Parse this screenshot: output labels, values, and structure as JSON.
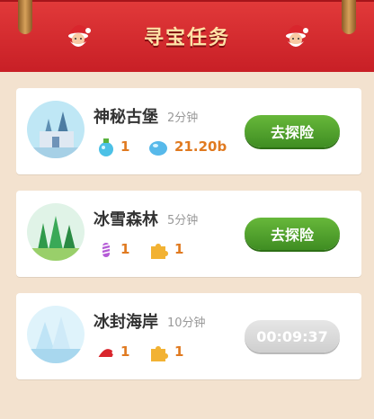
{
  "header": {
    "title": "寻宝任务"
  },
  "tasks": [
    {
      "name": "神秘古堡",
      "duration": "2分钟",
      "rewards": [
        {
          "icon": "potion-icon",
          "value": "1"
        },
        {
          "icon": "diamond-icon",
          "value": "21.20b"
        }
      ],
      "action": "去探险"
    },
    {
      "name": "冰雪森林",
      "duration": "5分钟",
      "rewards": [
        {
          "icon": "candy-icon",
          "value": "1"
        },
        {
          "icon": "puzzle-piece-icon",
          "value": "1"
        }
      ],
      "action": "去探险"
    },
    {
      "name": "冰封海岸",
      "duration": "10分钟",
      "rewards": [
        {
          "icon": "santa-hat-icon",
          "value": "1"
        },
        {
          "icon": "puzzle-piece-icon",
          "value": "1"
        }
      ],
      "action": "00:09:37"
    }
  ]
}
